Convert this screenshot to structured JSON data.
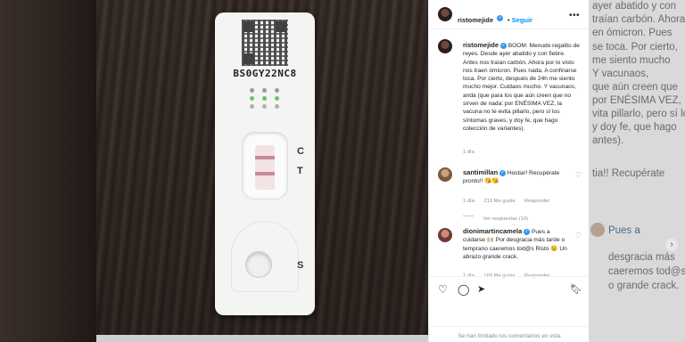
{
  "post": {
    "author": "ristomejide",
    "follow_label": "Seguir",
    "caption": "BOOM. Menudo regalito de reyes. Desde ayer abatido y con fiebre. Antes nos traían carbón. Ahora por lo visto nos traen ómicron. Pues nada. A confinarse toca. Por cierto, después de 24h me siento mucho mejor. Cuidaos mucho. Y vacunaos, anda (que para los que aún creen que no sirven de nada: por ENÉSIMA VEZ, la vacuna no te evita pillarlo, pero sí los síntomas graves, y doy fe, que hago colección de variantes).",
    "age": "1 día"
  },
  "test_card": {
    "code": "BS0GY22NC8",
    "label_c": "C",
    "label_t": "T",
    "label_s": "S",
    "line_color": "#c98a97"
  },
  "comments": [
    {
      "user": "santimillan",
      "text": "Hostia!! Recupérate pronto!! 😘😘",
      "age": "1 día",
      "likes": "219 Me gusta",
      "replies": "Ver respuestas (19)"
    },
    {
      "user": "dionimartincamela",
      "text": "Pues a cuidarse 🙌🏼 Por desgracia más tarde o temprano caeremos tod@s Risto 😉 Un abrazo grande crack.",
      "age": "1 día",
      "likes": "169 Me gusta"
    }
  ],
  "footer": {
    "disabled_text": "Se han limitado los comentarios en esta"
  },
  "background_right": {
    "lines": [
      "ayer abatido y con",
      "traían carbón. Ahora",
      "en ómicron. Pues",
      "se toca. Por cierto,",
      "me siento mucho",
      "Y vacunaos,",
      "que aún creen que",
      "por ENÉSIMA VEZ,",
      "vita pillarlo, pero sí los",
      "y doy fe, que hago",
      "antes)."
    ],
    "comment1": "tia!! Recupérate",
    "comment2_lines": [
      "Pues a",
      "desgracia más",
      "caeremos tod@s",
      "o grande crack."
    ]
  },
  "colors": {
    "link_blue": "#0095f6",
    "verified_blue": "#3897f0",
    "meta_gray": "#8e8e8e"
  }
}
